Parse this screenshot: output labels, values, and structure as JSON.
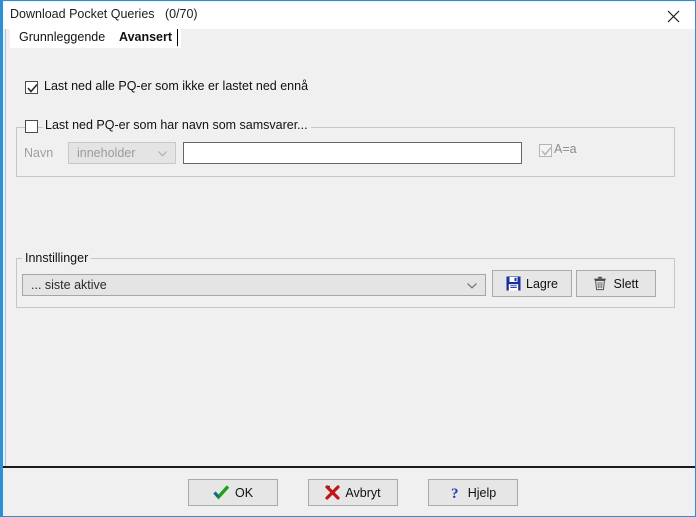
{
  "window": {
    "title": "Download Pocket Queries   (0/70)",
    "close_icon": "close-icon",
    "accent_color": "#2f8fd4",
    "background": "#f0f0f0"
  },
  "tabs": [
    {
      "label": "Grunnleggende",
      "active": false
    },
    {
      "label": "Avansert",
      "active": true
    }
  ],
  "options": {
    "download_all": {
      "label": "Last ned alle PQ-er som ikke er lastet ned ennå",
      "checked": true,
      "enabled": true
    },
    "name_match": {
      "label": "Last ned PQ-er som har navn som samsvarer...",
      "checked": false,
      "enabled": true,
      "name_label": "Navn",
      "operator_value": "inneholder",
      "operator_options": [
        "inneholder"
      ],
      "operator_enabled": false,
      "text_value": "",
      "text_placeholder": "",
      "case_label": "A=a",
      "case_checked": true,
      "case_enabled": false
    }
  },
  "settings": {
    "group_title": "Innstillinger",
    "preset_value": "... siste aktive",
    "preset_options": [
      "... siste aktive"
    ],
    "save_button": "Lagre",
    "save_icon": "floppy-disk-icon",
    "delete_button": "Slett",
    "delete_icon": "trash-icon"
  },
  "footer": {
    "ok_label": "OK",
    "ok_icon": "green-check-icon",
    "cancel_label": "Avbryt",
    "cancel_icon": "red-x-icon",
    "help_label": "Hjelp",
    "help_icon": "blue-question-icon"
  }
}
